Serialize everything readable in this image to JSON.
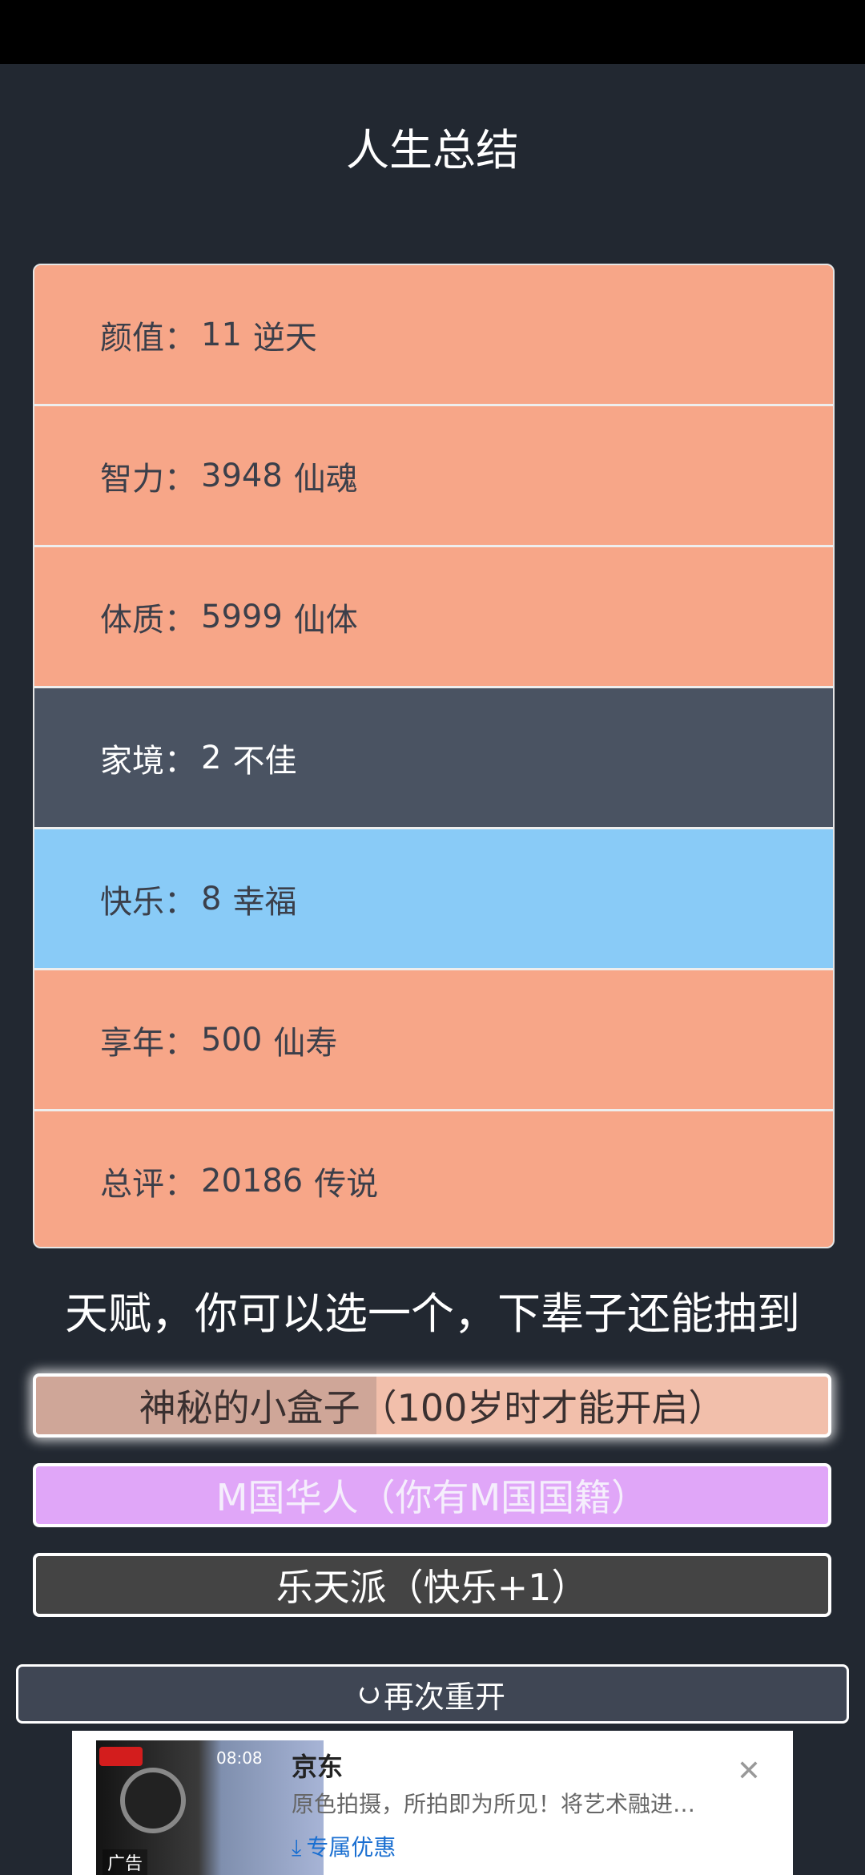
{
  "title": "人生总结",
  "stats": [
    {
      "label": "颜值：",
      "value": "11",
      "grade": "逆天",
      "color": "#f7a688"
    },
    {
      "label": "智力：",
      "value": "3948",
      "grade": "仙魂",
      "color": "#f7a688"
    },
    {
      "label": "体质：",
      "value": "5999",
      "grade": "仙体",
      "color": "#f7a688"
    },
    {
      "label": "家境：",
      "value": "2",
      "grade": "不佳",
      "color": "#4a5362"
    },
    {
      "label": "快乐：",
      "value": "8",
      "grade": "幸福",
      "color": "#89cbf7"
    },
    {
      "label": "享年：",
      "value": "500",
      "grade": "仙寿",
      "color": "#f7a688"
    },
    {
      "label": "总评：",
      "value": "20186",
      "grade": "传说",
      "color": "#f7a688"
    }
  ],
  "talent_heading": "天赋，你可以选一个，下辈子还能抽到",
  "talents": [
    {
      "text": "神秘的小盒子（100岁时才能开启）",
      "progress": 0.43
    },
    {
      "text": "M国华人（你有M国国籍）"
    },
    {
      "text": "乐天派（快乐+1）"
    }
  ],
  "restart_label": "再次重开",
  "ad": {
    "brand": "京东",
    "description": "原色拍摄，所拍即为所见！将艺术融进…",
    "cta": "专属优惠",
    "tag": "广告",
    "time": "08:08",
    "close_icon": "close-icon"
  }
}
